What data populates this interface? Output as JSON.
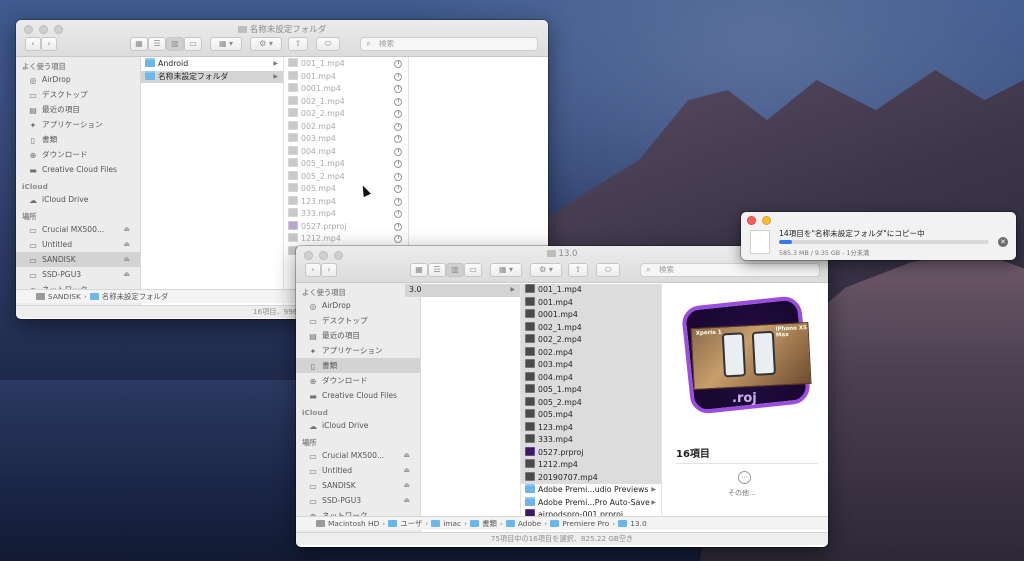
{
  "window_back": {
    "title": "名称未設定フォルダ",
    "search_placeholder": "検索",
    "favorites_header": "よく使う項目",
    "favorites": [
      {
        "label": "AirDrop",
        "icon": "airdrop-icon"
      },
      {
        "label": "デスクトップ",
        "icon": "desktop-icon"
      },
      {
        "label": "最近の項目",
        "icon": "recents-icon"
      },
      {
        "label": "アプリケーション",
        "icon": "applications-icon"
      },
      {
        "label": "書類",
        "icon": "documents-icon"
      },
      {
        "label": "ダウンロード",
        "icon": "downloads-icon"
      },
      {
        "label": "Creative Cloud Files",
        "icon": "folder-icon"
      }
    ],
    "icloud_header": "iCloud",
    "icloud": [
      {
        "label": "iCloud Drive",
        "icon": "cloud-icon"
      }
    ],
    "locations_header": "場所",
    "locations": [
      {
        "label": "Crucial MX500...",
        "icon": "drive-icon",
        "eject": true
      },
      {
        "label": "Untitled",
        "icon": "drive-icon",
        "eject": true
      },
      {
        "label": "SANDISK",
        "icon": "drive-icon",
        "eject": true,
        "selected": true
      },
      {
        "label": "SSD-PGU3",
        "icon": "drive-icon",
        "eject": true
      },
      {
        "label": "ネットワーク",
        "icon": "network-icon",
        "eject": false
      }
    ],
    "column1": [
      {
        "label": "Android",
        "type": "folder",
        "arrow": true
      },
      {
        "label": "名称未設定フォルダ",
        "type": "folder",
        "arrow": true,
        "selected": true
      }
    ],
    "column2": [
      {
        "label": "001_1.mp4",
        "type": "video"
      },
      {
        "label": "001.mp4",
        "type": "video"
      },
      {
        "label": "0001.mp4",
        "type": "video"
      },
      {
        "label": "002_1.mp4",
        "type": "video"
      },
      {
        "label": "002_2.mp4",
        "type": "video"
      },
      {
        "label": "002.mp4",
        "type": "video"
      },
      {
        "label": "003.mp4",
        "type": "video"
      },
      {
        "label": "004.mp4",
        "type": "video"
      },
      {
        "label": "005_1.mp4",
        "type": "video"
      },
      {
        "label": "005_2.mp4",
        "type": "video"
      },
      {
        "label": "005.mp4",
        "type": "video"
      },
      {
        "label": "123.mp4",
        "type": "video"
      },
      {
        "label": "333.mp4",
        "type": "video"
      },
      {
        "label": "0527.prproj",
        "type": "proj"
      },
      {
        "label": "1212.mp4",
        "type": "video"
      },
      {
        "label": "201...",
        "type": "video"
      }
    ],
    "path": [
      "SANDISK",
      "名称未設定フォルダ"
    ],
    "status": "16項目、996.7..."
  },
  "window_front": {
    "title": "13.0",
    "search_placeholder": "検索",
    "favorites_header": "よく使う項目",
    "favorites": [
      {
        "label": "AirDrop",
        "icon": "airdrop-icon"
      },
      {
        "label": "デスクトップ",
        "icon": "desktop-icon"
      },
      {
        "label": "最近の項目",
        "icon": "recents-icon"
      },
      {
        "label": "アプリケーション",
        "icon": "applications-icon"
      },
      {
        "label": "書類",
        "icon": "documents-icon",
        "selected": true
      },
      {
        "label": "ダウンロード",
        "icon": "downloads-icon"
      },
      {
        "label": "Creative Cloud Files",
        "icon": "folder-icon"
      }
    ],
    "icloud_header": "iCloud",
    "icloud": [
      {
        "label": "iCloud Drive",
        "icon": "cloud-icon"
      }
    ],
    "locations_header": "場所",
    "locations": [
      {
        "label": "Crucial MX500...",
        "icon": "drive-icon",
        "eject": true
      },
      {
        "label": "Untitled",
        "icon": "drive-icon",
        "eject": true
      },
      {
        "label": "SANDISK",
        "icon": "drive-icon",
        "eject": true
      },
      {
        "label": "SSD-PGU3",
        "icon": "drive-icon",
        "eject": true
      },
      {
        "label": "ネットワーク",
        "icon": "network-icon",
        "eject": false
      }
    ],
    "column1": [
      {
        "label": "3.0",
        "type": "none",
        "arrow": true,
        "selected": true
      }
    ],
    "column2": [
      {
        "label": "001_1.mp4",
        "type": "video",
        "selected": true
      },
      {
        "label": "001.mp4",
        "type": "video",
        "selected": true
      },
      {
        "label": "0001.mp4",
        "type": "video",
        "selected": true
      },
      {
        "label": "002_1.mp4",
        "type": "video",
        "selected": true
      },
      {
        "label": "002_2.mp4",
        "type": "video",
        "selected": true
      },
      {
        "label": "002.mp4",
        "type": "video",
        "selected": true
      },
      {
        "label": "003.mp4",
        "type": "video",
        "selected": true
      },
      {
        "label": "004.mp4",
        "type": "video",
        "selected": true
      },
      {
        "label": "005_1.mp4",
        "type": "video",
        "selected": true
      },
      {
        "label": "005_2.mp4",
        "type": "video",
        "selected": true
      },
      {
        "label": "005.mp4",
        "type": "video",
        "selected": true
      },
      {
        "label": "123.mp4",
        "type": "video",
        "selected": true
      },
      {
        "label": "333.mp4",
        "type": "video",
        "selected": true
      },
      {
        "label": "0527.prproj",
        "type": "proj",
        "selected": true
      },
      {
        "label": "1212.mp4",
        "type": "video",
        "selected": true
      },
      {
        "label": "20190707.mp4",
        "type": "video",
        "selected": true
      },
      {
        "label": "Adobe Premi...udio Previews",
        "type": "folder",
        "arrow": true
      },
      {
        "label": "Adobe Premi...Pro Auto-Save",
        "type": "folder",
        "arrow": true
      },
      {
        "label": "airpodspro-001.prproj",
        "type": "proj"
      }
    ],
    "preview": {
      "thumb_labels": [
        "Xperia 1",
        "iPhone XS Max"
      ],
      "proj_text": ".roj",
      "count": "16項目",
      "more_label": "その他..."
    },
    "path": [
      "Macintosh HD",
      "ユーザ",
      "imac",
      "書類",
      "Adobe",
      "Premiere Pro",
      "13.0"
    ],
    "status": "75項目中の16項目を選択、825.22 GB空き"
  },
  "copy_panel": {
    "title": "14項目を\"名称未設定フォルダ\"にコピー中",
    "progress_fraction": 0.061,
    "subtitle": "585.3 MB / 9.35 GB - 1分未満",
    "accent": "#3478f6"
  }
}
